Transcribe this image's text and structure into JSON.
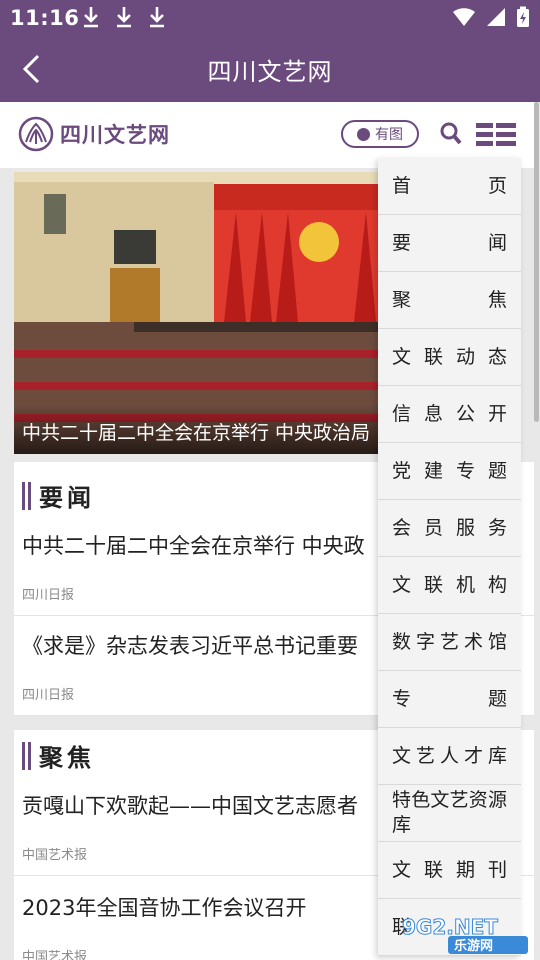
{
  "status": {
    "time": "11:16"
  },
  "titlebar": {
    "title": "四川文艺网"
  },
  "header": {
    "logo_text": "四川文艺网",
    "badge_label": "有图"
  },
  "hero": {
    "caption": "中共二十届二中全会在京举行 中央政治局"
  },
  "sections": [
    {
      "title": "要闻",
      "items": [
        {
          "title": "中共二十届二中全会在京举行 中央政",
          "source": "四川日报"
        },
        {
          "title": "《求是》杂志发表习近平总书记重要",
          "source": "四川日报"
        }
      ]
    },
    {
      "title": "聚焦",
      "items": [
        {
          "title": "贡嘎山下欢歌起——中国文艺志愿者",
          "source": "中国艺术报"
        },
        {
          "title": "2023年全国音协工作会议召开",
          "source": "中国艺术报"
        }
      ]
    }
  ],
  "menu": [
    "首页",
    "要闻",
    "聚焦",
    "文联动态",
    "信息公开",
    "党建专题",
    "会员服务",
    "文联机构",
    "数字艺术馆",
    "专题",
    "文艺人才库",
    "特色文艺资源库",
    "文联期刊",
    "联"
  ],
  "watermark": {
    "line1": "9G2.NET",
    "line2": "乐游网"
  },
  "colors": {
    "brand": "#6b4a7e",
    "banner_red": "#d0282a"
  }
}
